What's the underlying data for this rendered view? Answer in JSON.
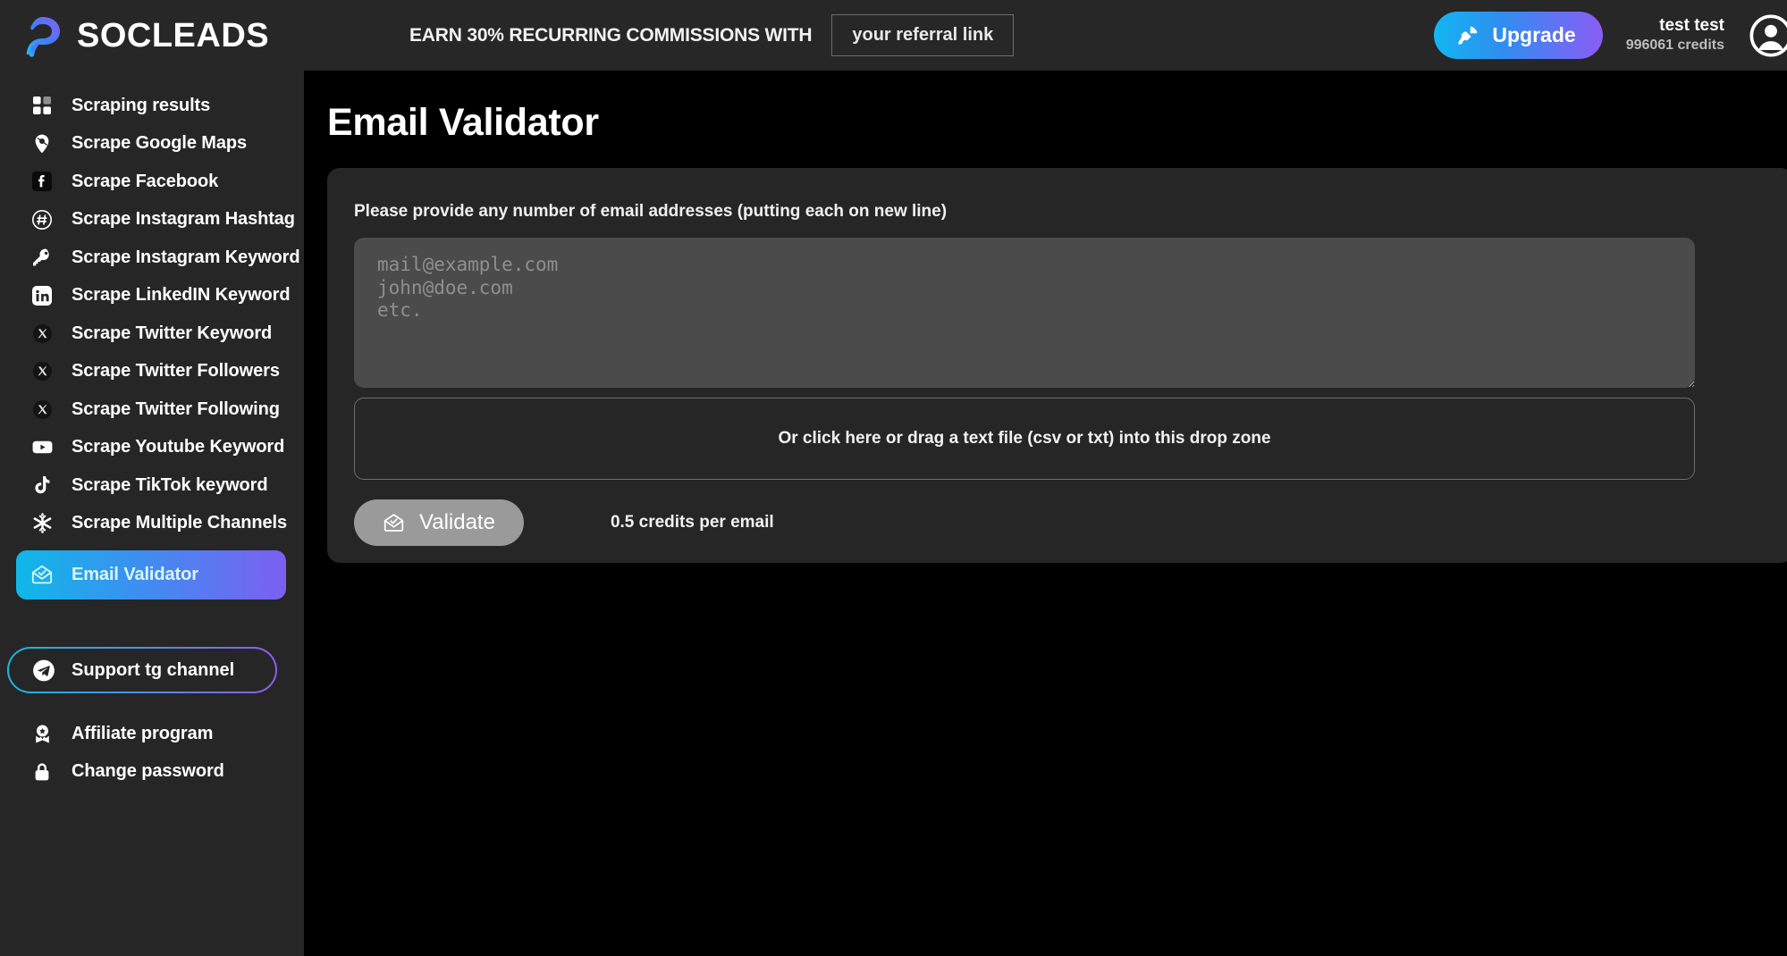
{
  "topbar": {
    "brand_name": "SOCLEADS",
    "brand_logo_icon": "socleads-logo-icon",
    "promo_text": "EARN 30% RECURRING COMMISSIONS WITH",
    "referral_placeholder": "your referral link",
    "referral_value": "your referral link",
    "upgrade_label": "Upgrade",
    "upgrade_icon": "rocket-icon",
    "user_name": "test test",
    "user_credits": "996061 credits",
    "avatar_icon": "user-avatar-icon",
    "accent_gradient_start": "#13b6f0",
    "accent_gradient_end": "#8b5cf6"
  },
  "sidebar": {
    "items": [
      {
        "label": "Scraping results",
        "icon": "grid-squares-icon",
        "active": false
      },
      {
        "label": "Scrape Google Maps",
        "icon": "map-pin-icon",
        "active": false
      },
      {
        "label": "Scrape Facebook",
        "icon": "facebook-icon",
        "active": false
      },
      {
        "label": "Scrape Instagram Hashtag",
        "icon": "hashtag-circle-icon",
        "active": false
      },
      {
        "label": "Scrape Instagram Keyword",
        "icon": "key-icon",
        "active": false
      },
      {
        "label": "Scrape LinkedIN Keyword",
        "icon": "linkedin-icon",
        "active": false
      },
      {
        "label": "Scrape Twitter Keyword",
        "icon": "x-twitter-icon",
        "active": false
      },
      {
        "label": "Scrape Twitter Followers",
        "icon": "x-twitter-icon",
        "active": false
      },
      {
        "label": "Scrape Twitter Following",
        "icon": "x-twitter-icon",
        "active": false
      },
      {
        "label": "Scrape Youtube Keyword",
        "icon": "youtube-icon",
        "active": false
      },
      {
        "label": "Scrape TikTok keyword",
        "icon": "tiktok-icon",
        "active": false
      },
      {
        "label": "Scrape Multiple Channels",
        "icon": "asterisk-icon",
        "active": false
      },
      {
        "label": "Email Validator",
        "icon": "envelope-check-icon",
        "active": true
      }
    ],
    "support": {
      "label": "Support tg channel",
      "icon": "telegram-icon"
    },
    "footer_items": [
      {
        "label": "Affiliate program",
        "icon": "award-badge-icon"
      },
      {
        "label": "Change password",
        "icon": "lock-icon"
      }
    ]
  },
  "main": {
    "page_title": "Email Validator",
    "card": {
      "label": "Please provide any number of email addresses (putting each on new line)",
      "textarea_placeholder": "mail@example.com\njohn@doe.com\netc.",
      "textarea_value": "",
      "dropzone_text": "Or click here or drag a text file (csv or txt) into this drop zone",
      "validate_label": "Validate",
      "validate_icon": "envelope-check-icon",
      "credits_note": "0.5 credits per email"
    }
  }
}
